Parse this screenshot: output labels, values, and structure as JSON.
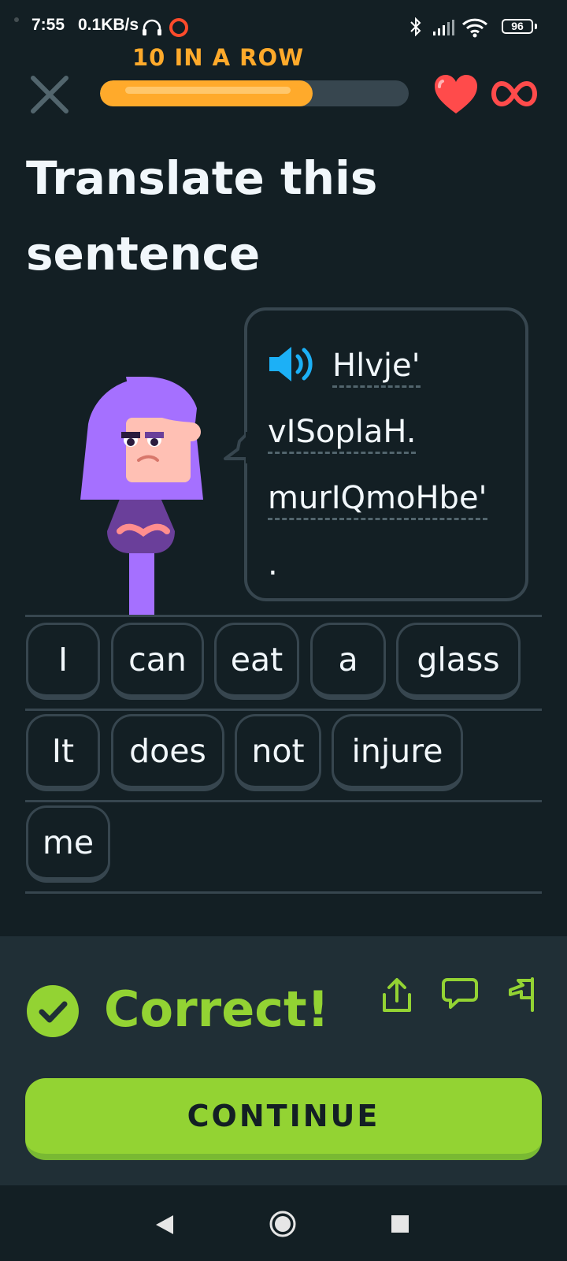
{
  "status_bar": {
    "time": "7:55",
    "network_speed": "0.1KB/s",
    "battery_level": "96",
    "icons": [
      "headphones-icon",
      "record-icon",
      "bluetooth-icon",
      "signal-icon",
      "wifi-icon",
      "battery-icon"
    ]
  },
  "header": {
    "streak_label": "10 IN A ROW",
    "progress_fraction": 0.69,
    "hearts": "∞"
  },
  "title": "Translate this sentence",
  "prompt": {
    "words": [
      "Hlvje'",
      "vISoplaH.",
      "murIQmoHbe'",
      "."
    ]
  },
  "word_bank": {
    "rows": [
      [
        "I",
        "can",
        "eat",
        "a",
        "glass"
      ],
      [
        "It",
        "does",
        "not",
        "injure"
      ],
      [
        "me"
      ]
    ]
  },
  "feedback": {
    "message": "Correct!",
    "continue_label": "CONTINUE"
  },
  "colors": {
    "background": "#131f24",
    "panel": "#202f36",
    "accent_green": "#93d333",
    "streak_orange": "#ffaa2b",
    "heart_red": "#ff4b4b",
    "speaker_blue": "#1cb0f6",
    "border": "#37464f"
  }
}
